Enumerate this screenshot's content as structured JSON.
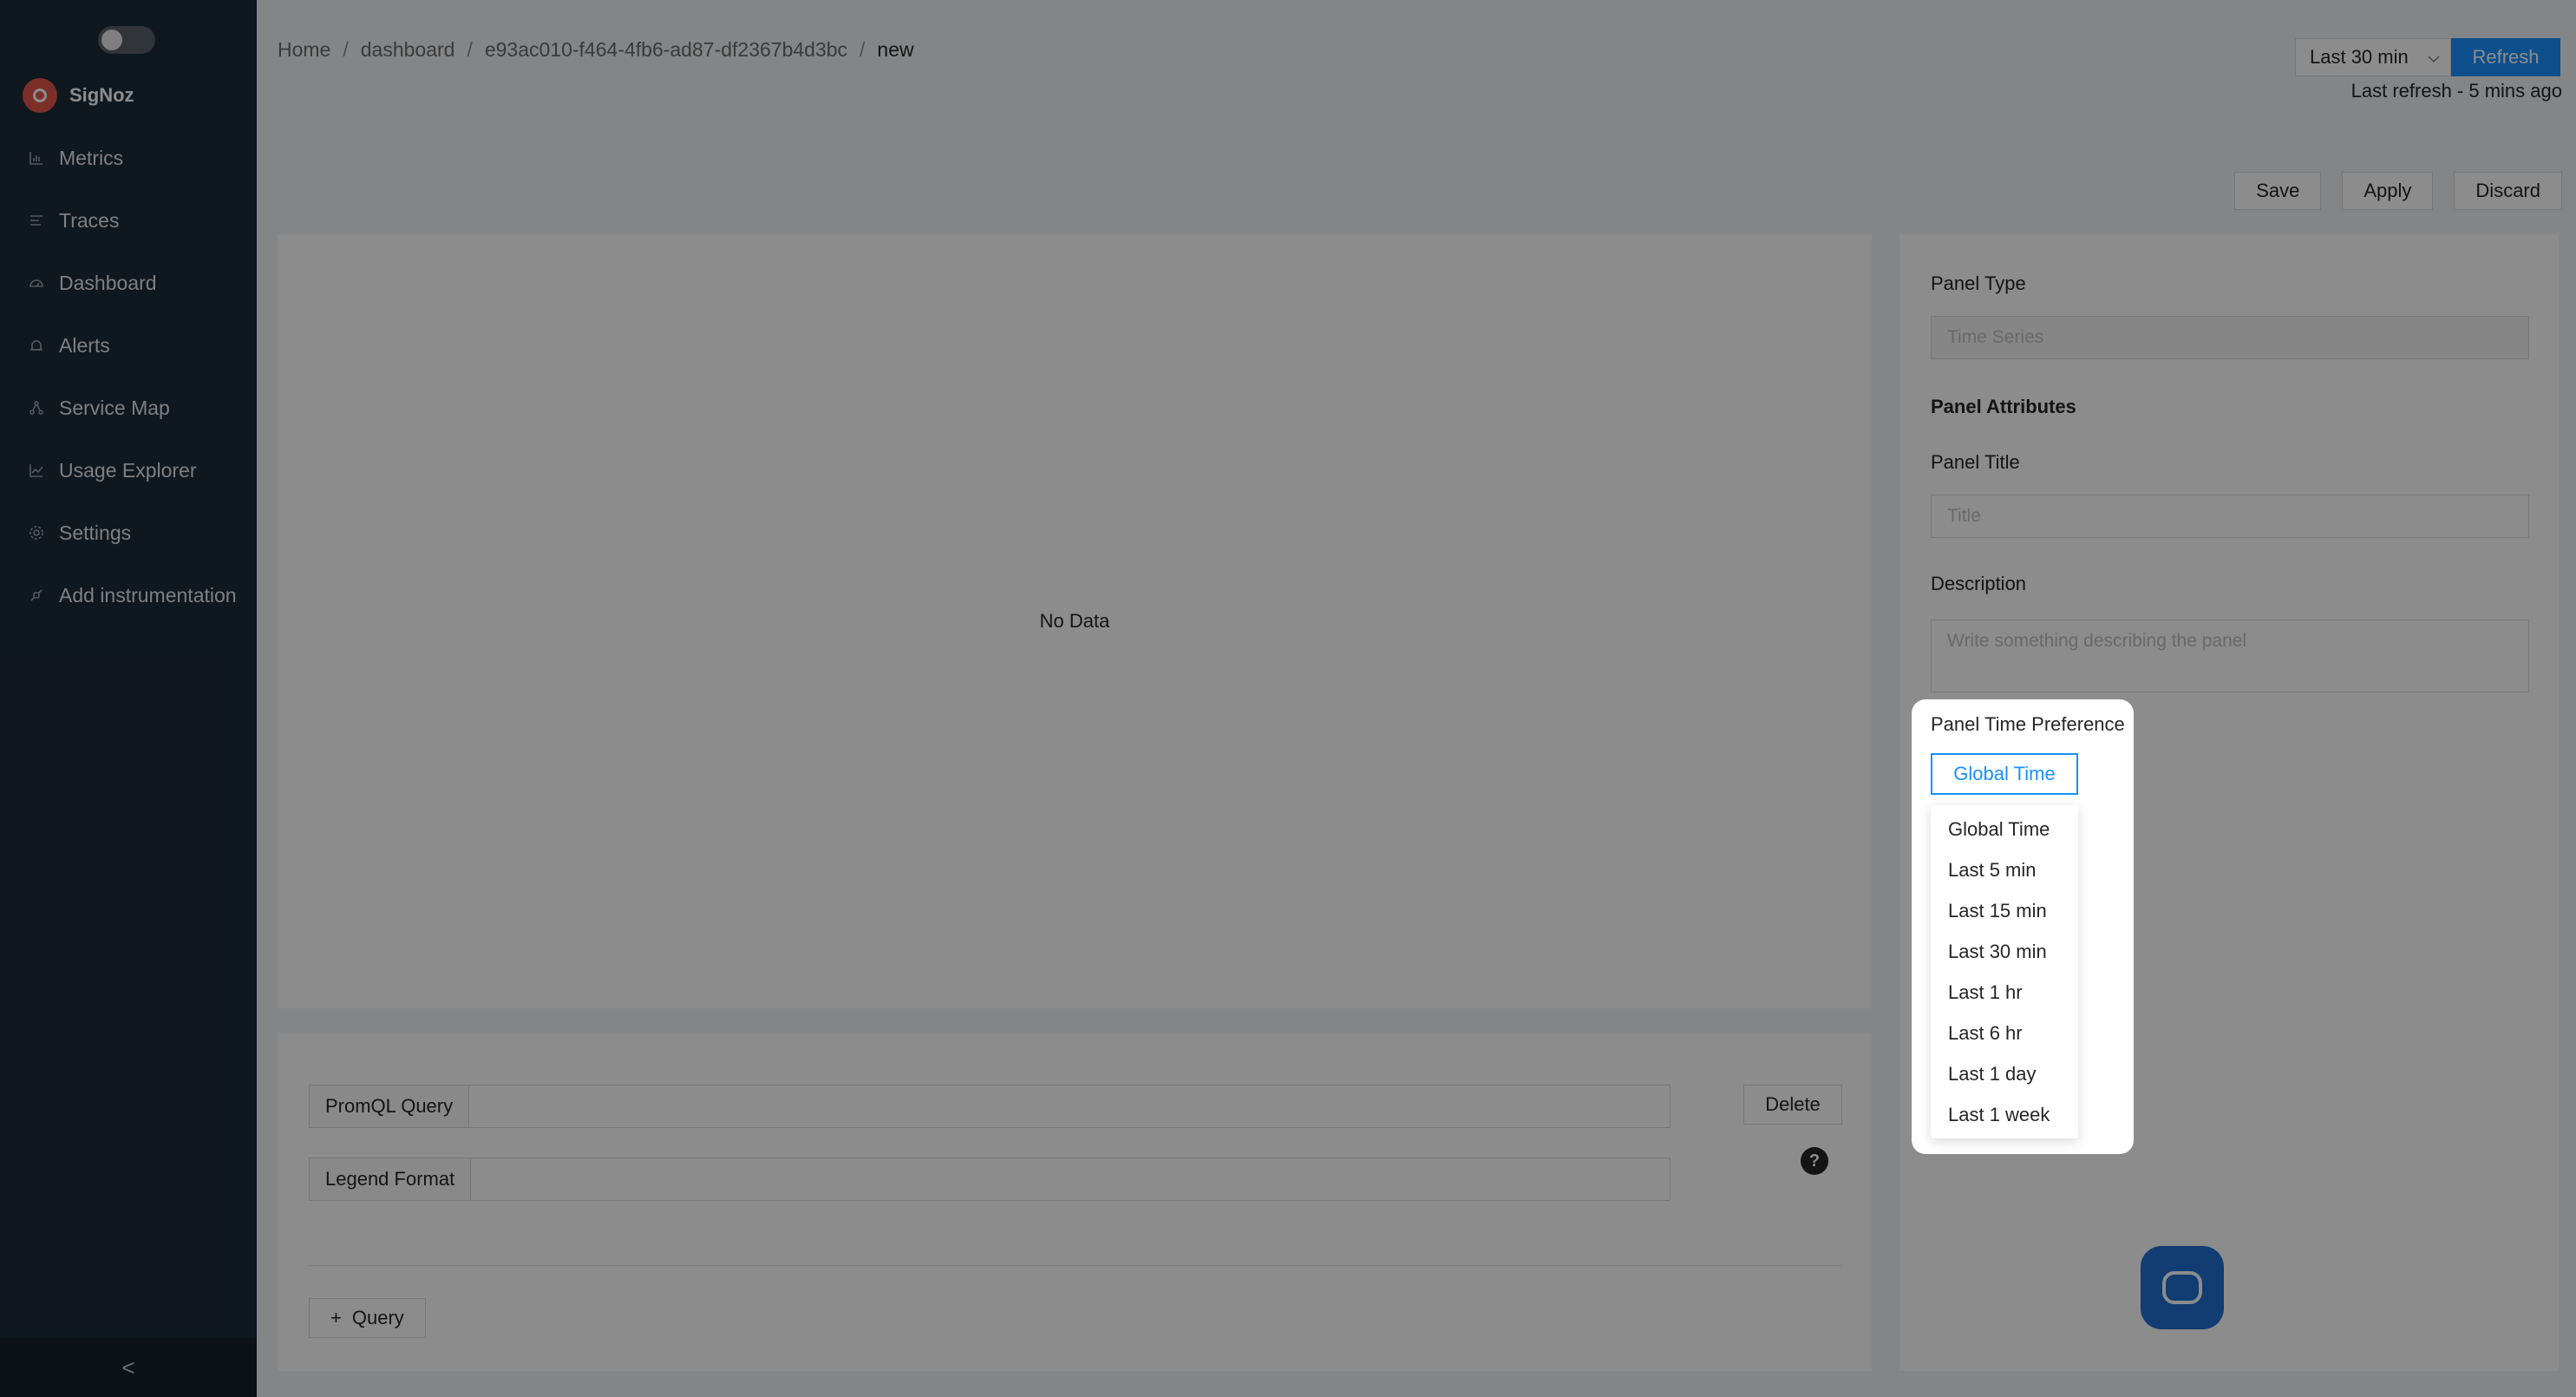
{
  "app": {
    "name": "SigNoz"
  },
  "sidebar": {
    "items": [
      {
        "label": "Metrics",
        "icon": "bar-chart-icon"
      },
      {
        "label": "Traces",
        "icon": "list-icon"
      },
      {
        "label": "Dashboard",
        "icon": "dashboard-icon"
      },
      {
        "label": "Alerts",
        "icon": "alarm-icon"
      },
      {
        "label": "Service Map",
        "icon": "deployment-unit-icon"
      },
      {
        "label": "Usage Explorer",
        "icon": "line-chart-icon"
      },
      {
        "label": "Settings",
        "icon": "gear-icon"
      },
      {
        "label": "Add instrumentation",
        "icon": "api-icon"
      }
    ],
    "collapse_glyph": "<"
  },
  "breadcrumb": {
    "home": "Home",
    "dashboard": "dashboard",
    "dashboard_id": "e93ac010-f464-4fb6-ad87-df2367b4d3bc",
    "current": "new",
    "separator": "/"
  },
  "header": {
    "time_range": "Last 30 min",
    "refresh_label": "Refresh",
    "last_refresh": "Last refresh - 5 mins ago"
  },
  "actions": {
    "save": "Save",
    "apply": "Apply",
    "discard": "Discard"
  },
  "graph": {
    "empty_text": "No Data"
  },
  "query": {
    "promql_label": "PromQL Query",
    "legend_label": "Legend Format",
    "delete_label": "Delete",
    "help_glyph": "?",
    "add_label": "Query",
    "add_glyph": "+"
  },
  "panel_settings": {
    "panel_type_label": "Panel Type",
    "panel_type_placeholder": "Time Series",
    "attributes_heading": "Panel Attributes",
    "title_label": "Panel Title",
    "title_placeholder": "Title",
    "description_label": "Description",
    "description_placeholder": "Write something describing the  panel",
    "time_pref_label": "Panel Time Preference",
    "time_pref_selected": "Global Time",
    "time_pref_options": [
      "Global Time",
      "Last 5 min",
      "Last 15 min",
      "Last 30 min",
      "Last 1 hr",
      "Last 6 hr",
      "Last 1 day",
      "Last 1 week"
    ]
  },
  "colors": {
    "sidebar_bg": "#1d2a3a",
    "primary": "#1890ff",
    "brand": "#e2574c"
  }
}
